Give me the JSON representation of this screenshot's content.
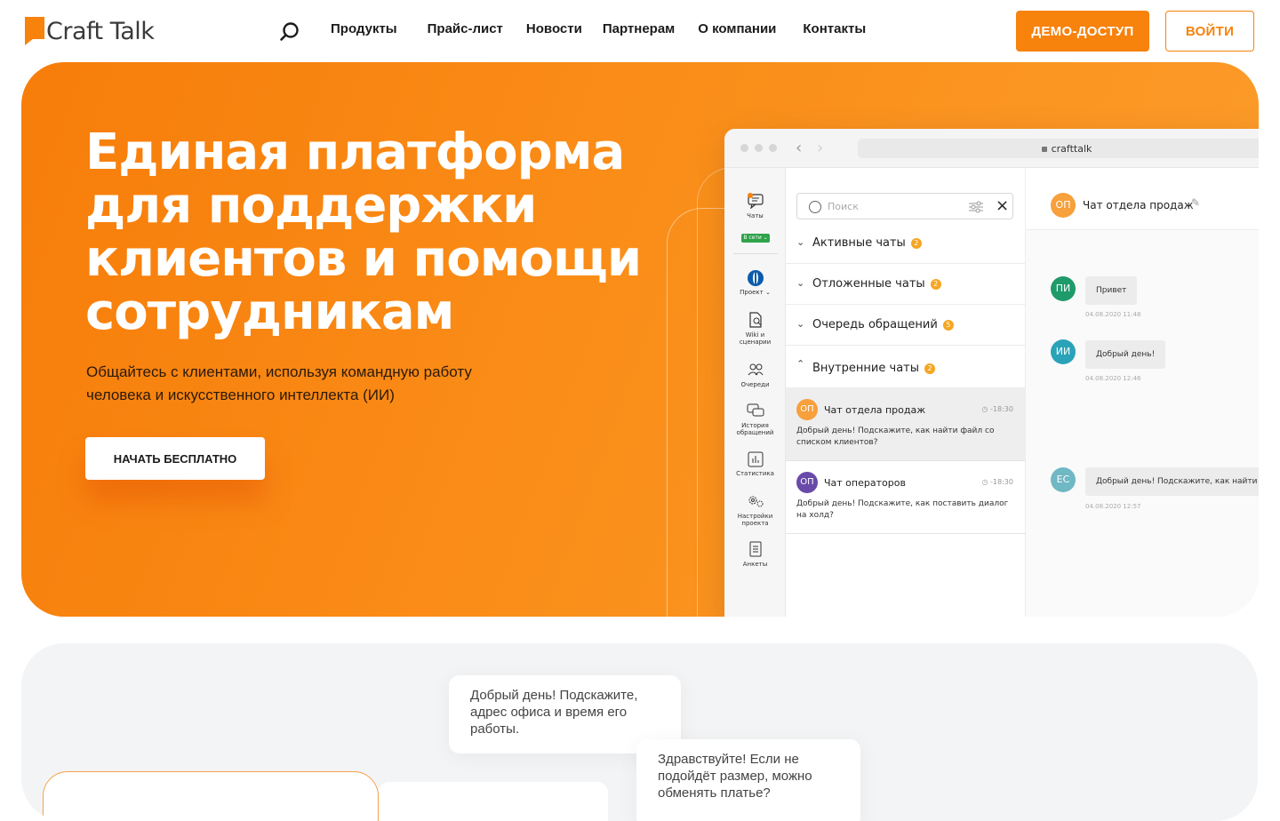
{
  "header": {
    "logo_text": "Craft Talk",
    "nav": [
      "Продукты",
      "Прайс-лист",
      "Новости",
      "Партнерам",
      "О компании",
      "Контакты"
    ],
    "demo_label": "ДЕМО-ДОСТУП",
    "login_label": "ВОЙТИ"
  },
  "hero": {
    "title": "Единая платформа для поддержки клиентов и помощи сотрудникам",
    "subtitle": "Общайтесь с клиентами, используя командную работу человека и искусственного интеллекта (ИИ)",
    "cta": "НАЧАТЬ БЕСПЛАТНО"
  },
  "app": {
    "url": "crafttalk",
    "sidebar": {
      "chats": "Чаты",
      "status": "В сети",
      "project": "Проект",
      "wiki": "Wiki и сценарии",
      "queues": "Очереди",
      "history": "История обращений",
      "stats": "Статистика",
      "settings": "Настройки проекта",
      "forms": "Анкеты"
    },
    "search_placeholder": "Поиск",
    "groups": [
      {
        "label": "Активные чаты",
        "count": "2"
      },
      {
        "label": "Отложенные чаты",
        "count": "2"
      },
      {
        "label": "Очередь обращений",
        "count": "5"
      },
      {
        "label": "Внутренние чаты",
        "count": "2"
      }
    ],
    "chats": [
      {
        "initials": "ОП",
        "title": "Чат отдела продаж",
        "time": "-18:30",
        "preview": "Добрый день! Подскажите, как найти файл со списком клиентов?"
      },
      {
        "initials": "ОП",
        "title": "Чат операторов",
        "time": "-18:30",
        "preview": "Добрый день! Подскажите, как поставить диалог на холд?"
      }
    ],
    "conversation": {
      "initials": "ОП",
      "title": "Чат отдела продаж",
      "messages": [
        {
          "initials": "ПИ",
          "text": "Привет",
          "time": "04.08.2020 11:48"
        },
        {
          "initials": "ИИ",
          "text": "Добрый день!",
          "time": "04.08.2020 12:46"
        },
        {
          "initials": "ЕС",
          "text": "Добрый день! Подскажите, как найти ф",
          "time": "04.08.2020 12:57"
        }
      ]
    }
  },
  "section2": {
    "bubble_1": "Добрый день! Подскажите, адрес офиса и время его работы.",
    "bubble_2": "Здравствуйте! Если не подойдёт размер, можно обменять платье?"
  },
  "colors": {
    "brand": "#f7820c",
    "green": "#1f9a6b",
    "teal": "#2aa3b8",
    "purple": "#6a4aa8"
  }
}
